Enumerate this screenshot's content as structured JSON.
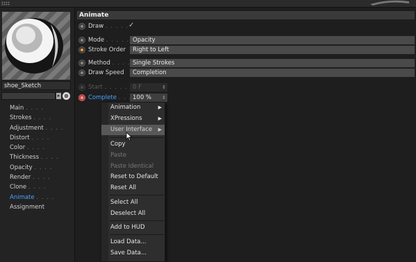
{
  "object": {
    "name": "shoe_Sketch"
  },
  "nav": {
    "items": [
      {
        "label": "Main",
        "active": false
      },
      {
        "label": "Strokes",
        "active": false
      },
      {
        "label": "Adjustment",
        "active": false
      },
      {
        "label": "Distort",
        "active": false
      },
      {
        "label": "Color",
        "active": false
      },
      {
        "label": "Thickness",
        "active": false
      },
      {
        "label": "Opacity",
        "active": false
      },
      {
        "label": "Render",
        "active": false
      },
      {
        "label": "Clone",
        "active": false
      },
      {
        "label": "Animate",
        "active": true
      },
      {
        "label": "Assignment",
        "active": false
      }
    ],
    "dots": ". . . ."
  },
  "section": {
    "title": "Animate"
  },
  "params": {
    "draw": {
      "label": "Draw",
      "dots": ". . . . .",
      "value": "✓"
    },
    "mode": {
      "label": "Mode",
      "dots": ". . . . .",
      "value": "Opacity"
    },
    "stroke_order": {
      "label": "Stroke Order",
      "value": "Right to Left"
    },
    "method": {
      "label": "Method",
      "dots": ". . . .",
      "value": "Single Strokes"
    },
    "draw_speed": {
      "label": "Draw Speed",
      "value": "Completion"
    },
    "start": {
      "label": "Start",
      "dots": ". . . . . .",
      "value": "0 F"
    },
    "complete": {
      "label": "Complete",
      "dots": ". . .",
      "value": "100 %"
    }
  },
  "context_menu": {
    "animation": "Animation",
    "xpressions": "XPressions",
    "user_interface": "User Interface",
    "copy": "Copy",
    "paste": "Paste",
    "paste_identical": "Paste Identical",
    "reset_to_default": "Reset to Default",
    "reset_all": "Reset All",
    "select_all": "Select All",
    "deselect_all": "Deselect All",
    "add_to_hud": "Add to HUD",
    "load_data": "Load Data...",
    "save_data": "Save Data...",
    "submenu_arrow": "▶"
  },
  "colors": {
    "accent_blue": "#4aa3ff",
    "accent_orange": "#ff9a2e",
    "keyframe_red": "#b84040"
  }
}
